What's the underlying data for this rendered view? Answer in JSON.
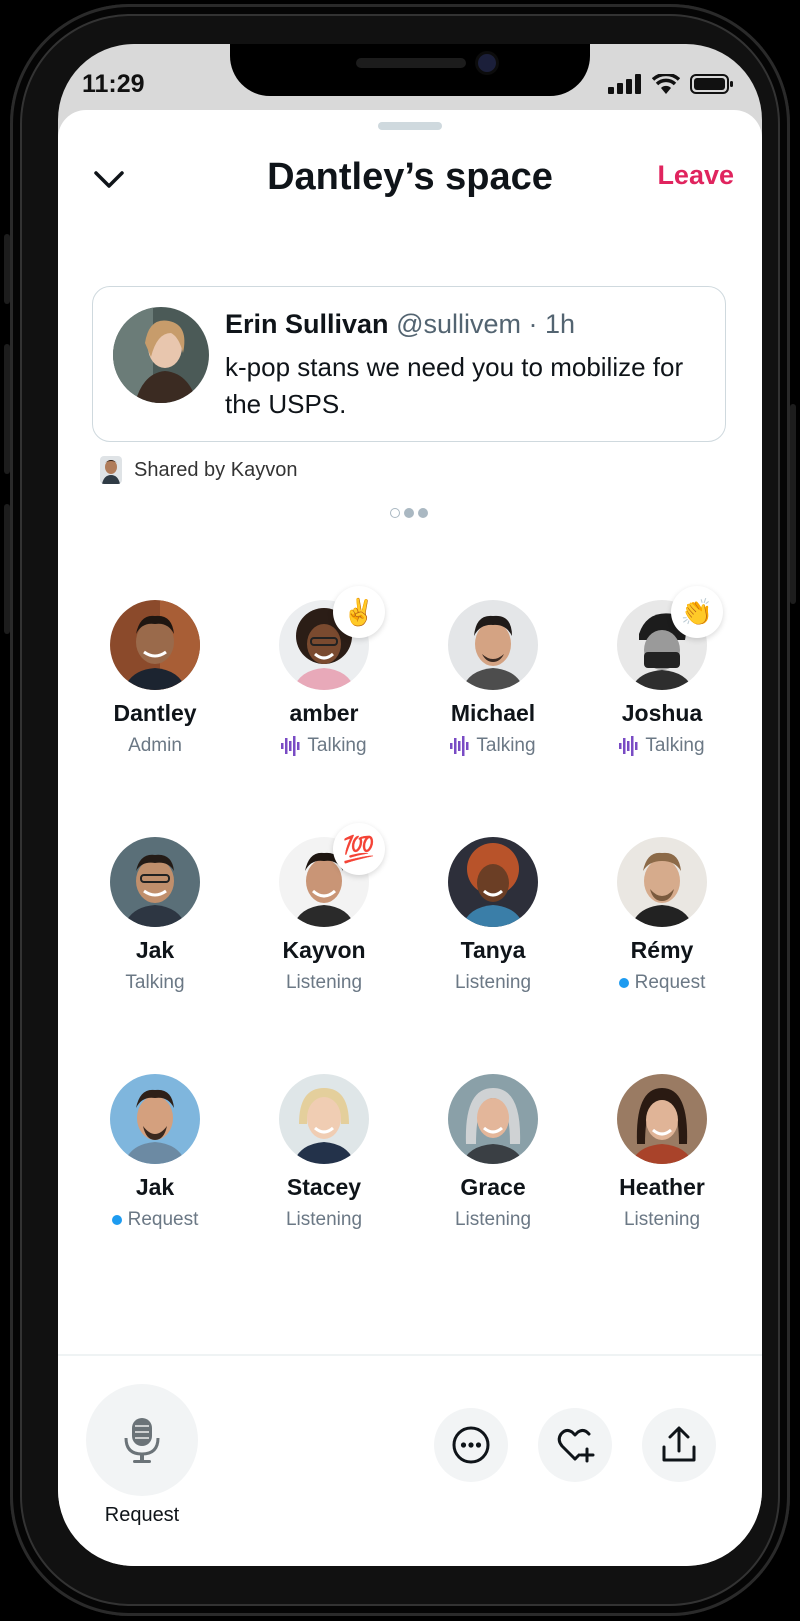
{
  "status_bar": {
    "time": "11:29"
  },
  "header": {
    "title": "Dantley’s space",
    "leave_label": "Leave"
  },
  "tweet": {
    "author_name": "Erin Sullivan",
    "handle": "@sullivem",
    "separator": "·",
    "age": "1h",
    "text": "k-pop stans we need you to mobilize for the USPS."
  },
  "shared_by": "Shared by Kayvon",
  "pager": {
    "pages": 3,
    "current": 1
  },
  "participants": [
    {
      "name": "Dantley",
      "status": "Admin"
    },
    {
      "name": "amber",
      "status": "Talking",
      "reaction": "✌️"
    },
    {
      "name": "Michael",
      "status": "Talking"
    },
    {
      "name": "Joshua",
      "status": "Talking",
      "reaction": "👏"
    },
    {
      "name": "Jak",
      "status": "Talking"
    },
    {
      "name": "Kayvon",
      "status": "Listening",
      "reaction": "💯"
    },
    {
      "name": "Tanya",
      "status": "Listening"
    },
    {
      "name": "Rémy",
      "status": "Request"
    },
    {
      "name": "Jak",
      "status": "Request"
    },
    {
      "name": "Stacey",
      "status": "Listening"
    },
    {
      "name": "Grace",
      "status": "Listening"
    },
    {
      "name": "Heather",
      "status": "Listening"
    }
  ],
  "footer": {
    "request_label": "Request"
  },
  "colors": {
    "accent_red": "#e0245e",
    "talking_purple": "#794bc4",
    "request_blue": "#1d9bf0"
  }
}
